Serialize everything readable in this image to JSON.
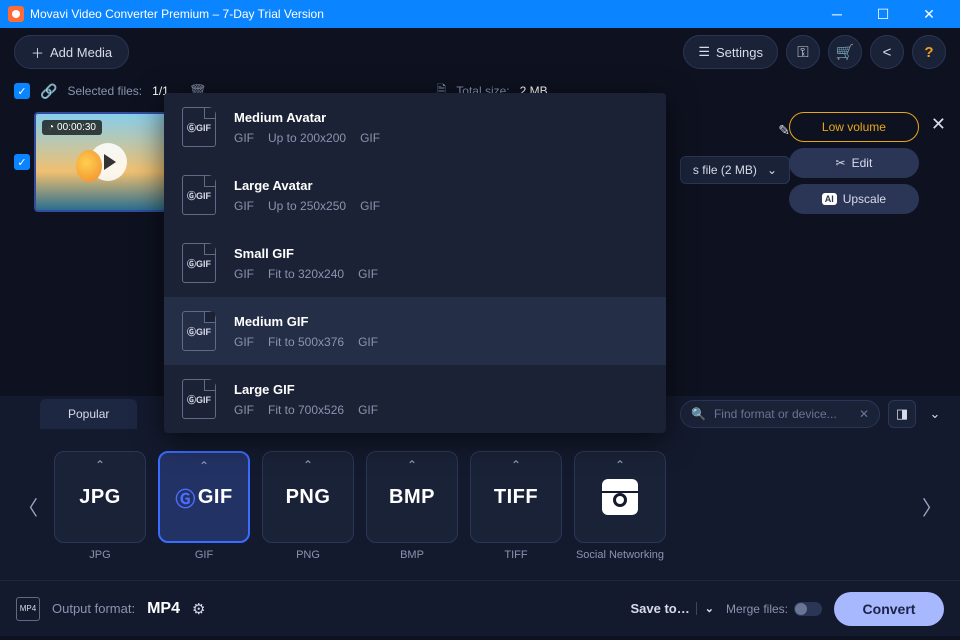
{
  "titlebar": {
    "title": "Movavi Video Converter Premium – 7-Day Trial Version"
  },
  "toolbar": {
    "add_media": "Add Media",
    "settings": "Settings"
  },
  "selection": {
    "label": "Selected files:",
    "count": "1/1",
    "total_size_label": "Total size:",
    "total_size_value": "2 MB"
  },
  "item": {
    "duration": "00:00:30"
  },
  "file_row": {
    "label": "s file (2 MB)"
  },
  "actions": {
    "low_volume": "Low volume",
    "edit": "Edit",
    "upscale": "Upscale"
  },
  "presets": [
    {
      "title": "Medium Avatar",
      "codec": "GIF",
      "dim": "Up to 200x200",
      "ext": "GIF"
    },
    {
      "title": "Large Avatar",
      "codec": "GIF",
      "dim": "Up to 250x250",
      "ext": "GIF"
    },
    {
      "title": "Small GIF",
      "codec": "GIF",
      "dim": "Fit to 320x240",
      "ext": "GIF"
    },
    {
      "title": "Medium GIF",
      "codec": "GIF",
      "dim": "Fit to 500x376",
      "ext": "GIF"
    },
    {
      "title": "Large GIF",
      "codec": "GIF",
      "dim": "Fit to 700x526",
      "ext": "GIF"
    }
  ],
  "tabs": {
    "popular": "Popular"
  },
  "search": {
    "placeholder": "Find format or device..."
  },
  "formats": [
    {
      "code": "JPG",
      "label": "JPG"
    },
    {
      "code": "GIF",
      "label": "GIF"
    },
    {
      "code": "PNG",
      "label": "PNG"
    },
    {
      "code": "BMP",
      "label": "BMP"
    },
    {
      "code": "TIFF",
      "label": "TIFF"
    },
    {
      "code": "",
      "label": "Social Networking"
    }
  ],
  "bottom": {
    "output_label": "Output format:",
    "output_value": "MP4",
    "save_to": "Save to…",
    "merge": "Merge files:",
    "convert": "Convert"
  }
}
